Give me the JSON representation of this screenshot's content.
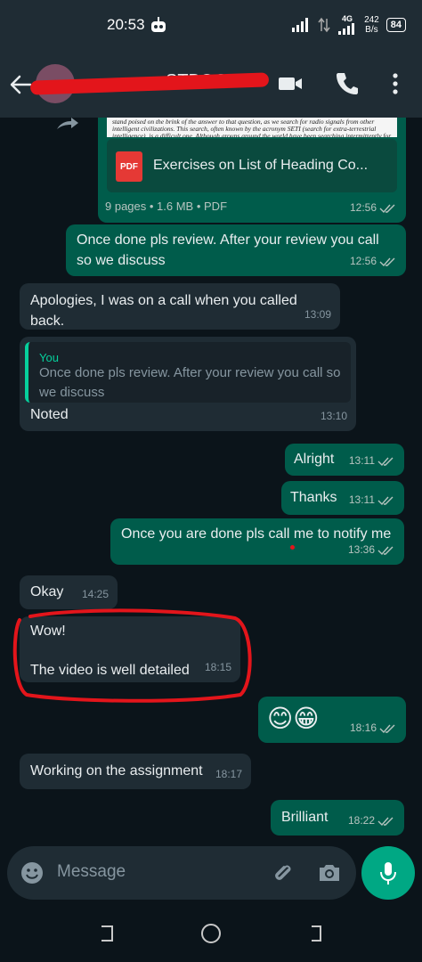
{
  "status": {
    "time": "20:53",
    "network": "4G",
    "speed_value": "242",
    "speed_unit": "B/s",
    "battery": "84"
  },
  "header": {
    "contact_name_visible": "STBOOK"
  },
  "messages": [
    {
      "type": "document",
      "direction": "out",
      "preview_text": "stand poised on the brink of the answer to that question, as we search for radio signals from other intelligent civilizations. This search, often known by the acronym SETI (search for extra-terrestrial intelligence), is a difficult one. Although groups around the world have been searching intermittently for",
      "file_badge": "PDF",
      "file_name": "Exercises on List of Heading Co...",
      "pages": "9 pages",
      "size": "1.6 MB",
      "kind": "PDF",
      "time": "12:56"
    },
    {
      "type": "text",
      "direction": "out",
      "text": "Once done pls review. After your review you call so we discuss",
      "time": "12:56"
    },
    {
      "type": "text",
      "direction": "in",
      "text": "Apologies, I was on a call when you called back.",
      "time": "13:09"
    },
    {
      "type": "reply",
      "direction": "in",
      "quote_author": "You",
      "quote_text": "Once done pls review. After your review you call so we discuss",
      "text": "Noted",
      "time": "13:10"
    },
    {
      "type": "text",
      "direction": "out",
      "text": "Alright",
      "time": "13:11"
    },
    {
      "type": "text",
      "direction": "out",
      "text": "Thanks",
      "time": "13:11"
    },
    {
      "type": "text",
      "direction": "out",
      "text": "Once you are done pls call me to notify me",
      "time": "13:36"
    },
    {
      "type": "text",
      "direction": "in",
      "text": "Okay",
      "time": "14:25"
    },
    {
      "type": "text",
      "direction": "in",
      "text": "Wow!\n\nThe video is well detailed",
      "time": "18:15"
    },
    {
      "type": "text",
      "direction": "out",
      "text": "😊😁",
      "time": "18:16"
    },
    {
      "type": "text",
      "direction": "in",
      "text": "Working on the assignment",
      "time": "18:17"
    },
    {
      "type": "text",
      "direction": "out",
      "text": "Brilliant",
      "time": "18:22"
    }
  ],
  "input": {
    "placeholder": "Message"
  },
  "icons": {
    "back": "arrow-left-icon",
    "video": "video-camera-icon",
    "call": "phone-icon",
    "menu": "kebab-menu-icon",
    "emoji": "emoji-icon",
    "attach": "paperclip-icon",
    "camera": "camera-icon",
    "mic": "microphone-icon",
    "forward": "forward-icon"
  },
  "colors": {
    "chat_bg": "#0b141a",
    "header_bg": "#1f2c34",
    "outgoing_bubble": "#005c4b",
    "incoming_bubble": "#1f2c34",
    "accent": "#00a884",
    "annotation_red": "#e3151b"
  }
}
